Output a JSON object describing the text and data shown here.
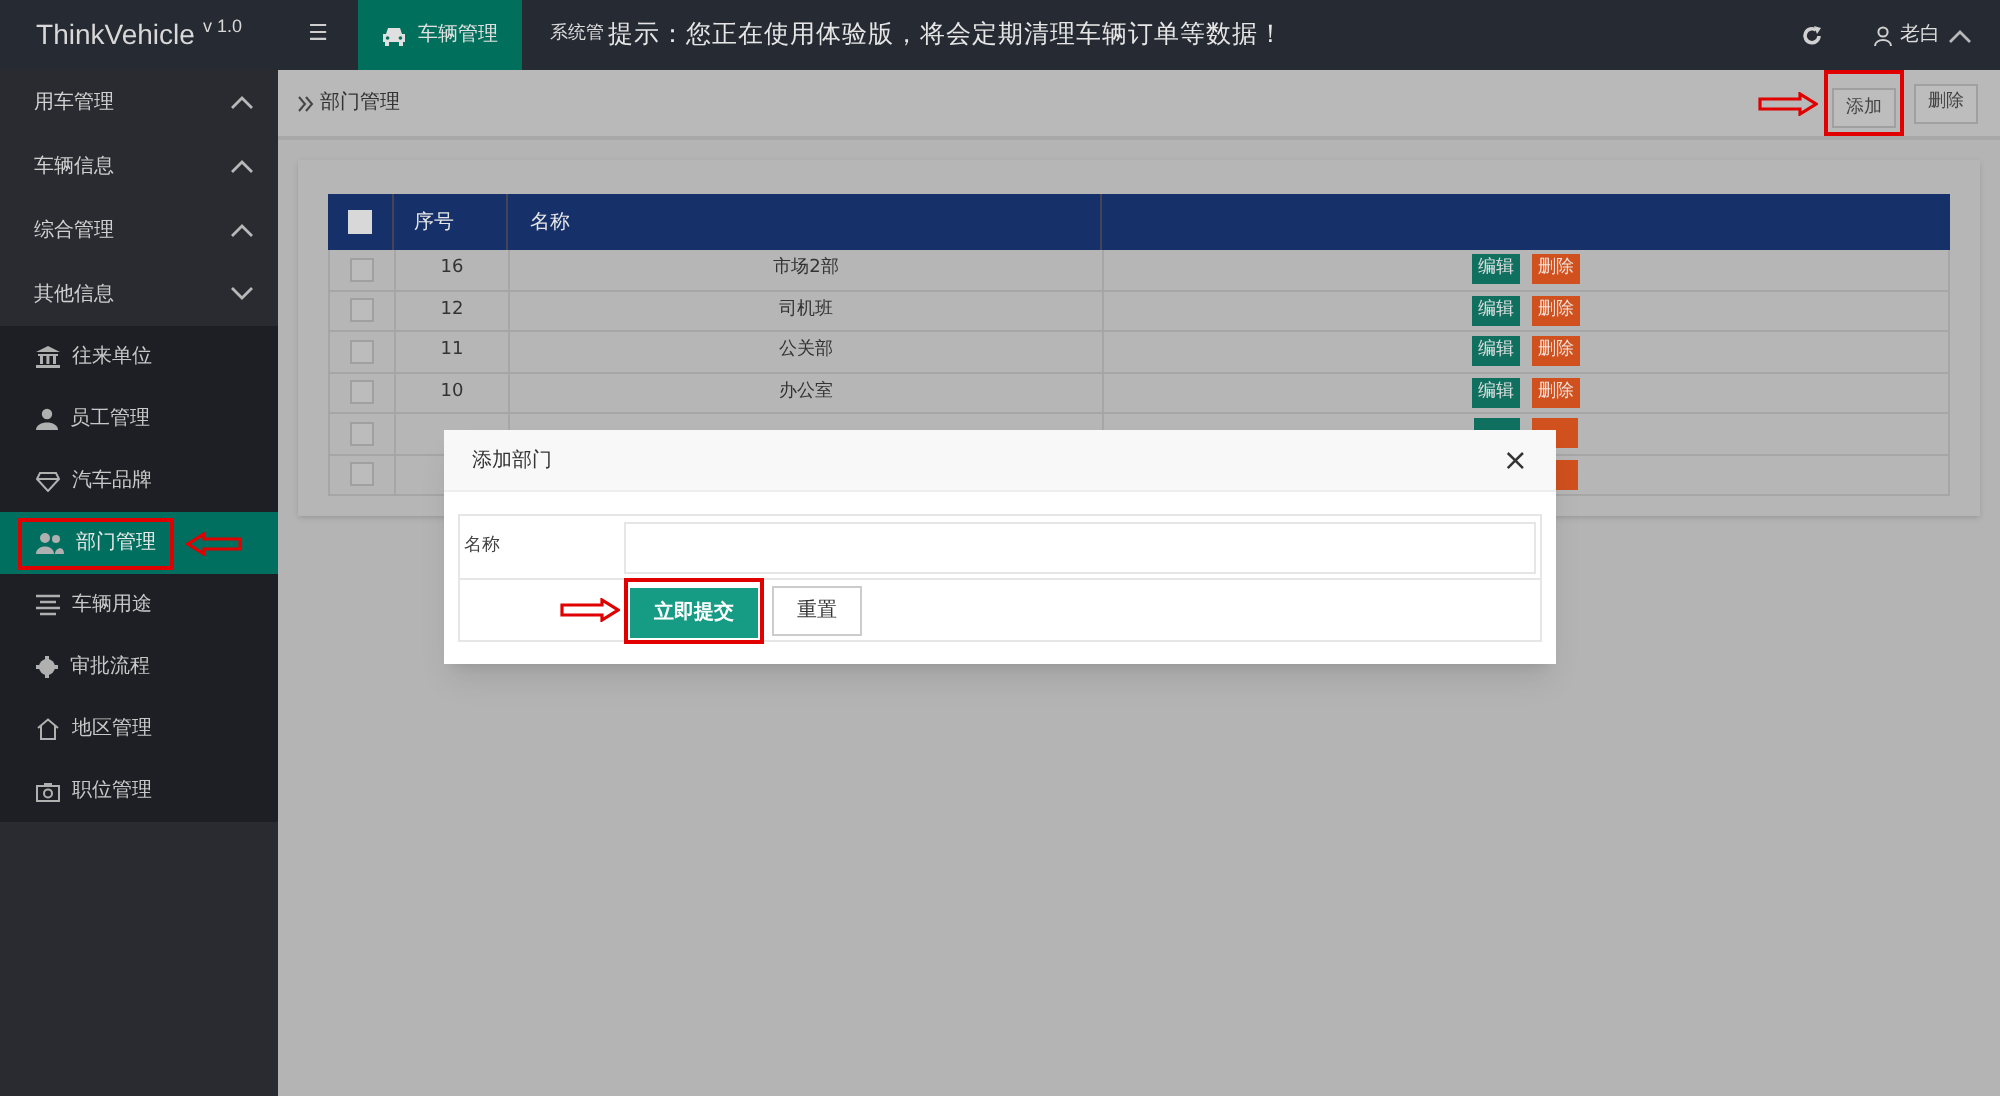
{
  "header": {
    "logo": "ThinkVehicle",
    "version": "v 1.0",
    "menu_icon": "☰",
    "active_tab": "车辆管理",
    "tab_cut": "系统管",
    "notice": "提示：您正在使用体验版，将会定期清理车辆订单等数据！",
    "user": "老白"
  },
  "sidebar": {
    "groups": [
      {
        "label": "用车管理",
        "expanded": false
      },
      {
        "label": "车辆信息",
        "expanded": false
      },
      {
        "label": "综合管理",
        "expanded": false
      },
      {
        "label": "其他信息",
        "expanded": true,
        "children": [
          {
            "label": "往来单位",
            "selected": false
          },
          {
            "label": "员工管理",
            "selected": false
          },
          {
            "label": "汽车品牌",
            "selected": false
          },
          {
            "label": "部门管理",
            "selected": true
          },
          {
            "label": "车辆用途",
            "selected": false
          },
          {
            "label": "审批流程",
            "selected": false
          },
          {
            "label": "地区管理",
            "selected": false
          },
          {
            "label": "职位管理",
            "selected": false
          }
        ]
      }
    ]
  },
  "breadcrumb": "部门管理",
  "toolbar": {
    "buttons": [
      "添加",
      "删除"
    ]
  },
  "table": {
    "columns": [
      "序号",
      "名称"
    ],
    "select_all_checked": false,
    "rows": [
      {
        "kind": "full",
        "checked": false,
        "id": "16",
        "name": "市场2部",
        "edit": "编辑",
        "delete": "删除"
      },
      {
        "kind": "full",
        "checked": false,
        "id": "12",
        "name": "司机班",
        "edit": "编辑",
        "delete": "删除"
      },
      {
        "kind": "full",
        "checked": false,
        "id": "11",
        "name": "公关部",
        "edit": "编辑",
        "delete": "删除"
      },
      {
        "kind": "full",
        "checked": false,
        "id": "10",
        "name": "办公室",
        "edit": "编辑",
        "delete": "删除"
      },
      {
        "kind": "covered",
        "checked": false
      },
      {
        "kind": "delete_only",
        "checked": false
      }
    ]
  },
  "dialog": {
    "title": "添加部门",
    "close": "×",
    "field_label": "名称",
    "submit": "立即提交",
    "reset": "重置"
  }
}
